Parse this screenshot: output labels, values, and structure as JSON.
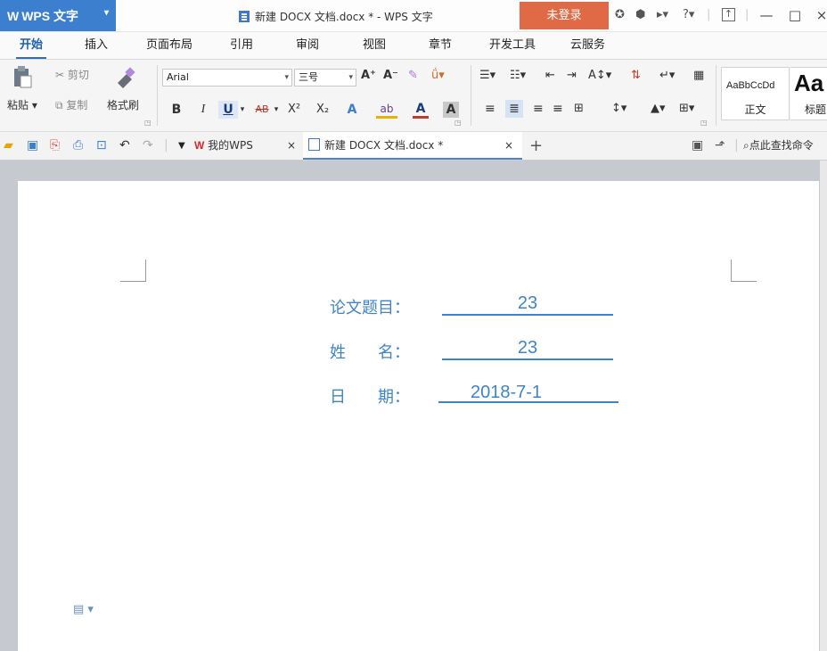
{
  "app": {
    "name": "WPS 文字",
    "logo": "W",
    "doc_title": "新建 DOCX 文档.docx * - WPS 文字",
    "login_label": "未登录",
    "title_icons": [
      "skin-icon",
      "settings-icon",
      "share-icon",
      "help-icon",
      "ribbon-toggle-icon"
    ],
    "help_label": "?",
    "minimize": "—",
    "maximize": "□",
    "close": "×"
  },
  "ribbon_tabs": [
    "开始",
    "插入",
    "页面布局",
    "引用",
    "审阅",
    "视图",
    "章节",
    "开发工具",
    "云服务"
  ],
  "active_tab": "开始",
  "clipboard": {
    "paste": "粘贴",
    "cut": "剪切",
    "copy": "复制",
    "format_painter": "格式刷"
  },
  "font": {
    "family": "Arial",
    "size": "三号",
    "grow": "A⁺",
    "shrink": "A⁻",
    "bold": "B",
    "italic": "I",
    "underline": "U",
    "strike": "AB",
    "superscript": "X²",
    "subscript": "X₂",
    "highlight": "ab",
    "font_color": "A",
    "char_shading": "A"
  },
  "styles": {
    "normal_preview": "AaBbCcDd",
    "normal_label": "正文",
    "heading_preview": "Aa",
    "heading_label": "标题"
  },
  "quick_access": {
    "home_tab": "我的WPS",
    "doc_tab": "新建 DOCX 文档.docx *",
    "search_placeholder": "点此查找命令",
    "tab_close": "×",
    "new_tab": "+"
  },
  "document": {
    "fields": [
      {
        "label": "论文题目：",
        "value": "23"
      },
      {
        "label": "姓　　名：",
        "value": "23"
      },
      {
        "label": "日　　期：",
        "value": "2018-7-1"
      }
    ]
  },
  "colors": {
    "accent": "#3d7fcf",
    "login": "#e06a45",
    "field_text": "#3f85c6",
    "workspace": "#c6cad0"
  }
}
